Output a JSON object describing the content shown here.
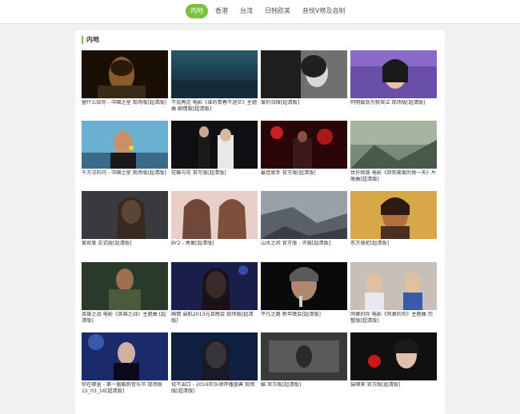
{
  "tabs": [
    {
      "label": "内地",
      "active": true
    },
    {
      "label": "香港",
      "active": false
    },
    {
      "label": "台湾",
      "active": false
    },
    {
      "label": "日韩欧美",
      "active": false
    },
    {
      "label": "音悦V榜及自制",
      "active": false
    }
  ],
  "section": {
    "title": "内地"
  },
  "videos": [
    {
      "caption": "留什么给你 - 中国之星 现场版[超清版]"
    },
    {
      "caption": "不说再见 电影《谁的青春不迷茫》主题曲 剧情版[超清版]"
    },
    {
      "caption": "爱的归宿[超清版]"
    },
    {
      "caption": "阿明鼓劲为我哭泣 现场版[超清版]"
    },
    {
      "caption": "千万次的问 - 中国之星 现场版[超清版]"
    },
    {
      "caption": "花瓣与花 官方版[超清版]"
    },
    {
      "caption": "最佳歌手 官方版[超清版]"
    },
    {
      "caption": "世外桃源 电影《回到被爱的每一天》片尾曲[超清版]"
    },
    {
      "caption": "爱就爱 正式版[超清版]"
    },
    {
      "caption": "BY2 - 勇敢[超清版]"
    },
    {
      "caption": "山水之间 官方版 - 许嵩[超清版]"
    },
    {
      "caption": "东方骑驼[超清版]"
    },
    {
      "caption": "英雄之战 电影《英雄之战》主题曲 [超清版]"
    },
    {
      "caption": "画情 启航2013元旦晚会 现场版[超清版]"
    },
    {
      "caption": "平凡之路 新年晚会[超清版]"
    },
    {
      "caption": "同桌的你 电影《同桌的你》主题曲 完整版[超清版]"
    },
    {
      "caption": "你在哪里 - 第一届酷狗音乐节 现场版 15_03_16[超清版]"
    },
    {
      "caption": "说不出口 - 2016欢乐颂开播盛典 现场版[超清版]"
    },
    {
      "caption": "酷 官方版[超清版]"
    },
    {
      "caption": "装嘀来 官方版[超清版]"
    }
  ]
}
